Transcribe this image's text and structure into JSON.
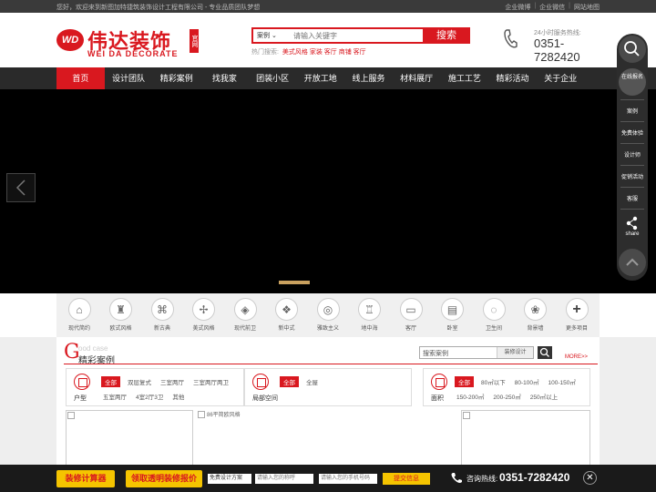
{
  "topbar": {
    "welcome": "您好，欢迎来到新图加特捷筑装饰设计工程有限公司 - 专业品质团队梦想",
    "links": [
      "企业微博",
      "企业微信",
      "网站地图"
    ]
  },
  "logo": {
    "badge": "WD",
    "cn": "伟达装饰",
    "en": "WEI DA DECORATE",
    "official": "官网"
  },
  "search": {
    "category": "案例",
    "placeholder": "请输入关键字",
    "button": "搜索",
    "hot_label": "热门搜索:",
    "hot_keywords": "美式风格 家装 客厅 商铺 客厅"
  },
  "hotline": {
    "label": "24小时服务热线:",
    "number": "0351-7282420"
  },
  "nav": [
    "首页",
    "设计团队",
    "精彩案例",
    "找我家",
    "团装小区",
    "开放工地",
    "线上服务",
    "材料展厅",
    "施工工艺",
    "精彩活动",
    "关于企业"
  ],
  "categories": [
    {
      "label": "现代简约",
      "glyph": "⌂"
    },
    {
      "label": "欧式风格",
      "glyph": "♜"
    },
    {
      "label": "新古典",
      "glyph": "⌘"
    },
    {
      "label": "美式风格",
      "glyph": "✢"
    },
    {
      "label": "现代前卫",
      "glyph": "◈"
    },
    {
      "label": "新中式",
      "glyph": "❖"
    },
    {
      "label": "雅致主义",
      "glyph": "◎"
    },
    {
      "label": "地中海",
      "glyph": "♖"
    },
    {
      "label": "客厅",
      "glyph": "▭"
    },
    {
      "label": "卧室",
      "glyph": "▤"
    },
    {
      "label": "卫生间",
      "glyph": "◌"
    },
    {
      "label": "背景墙",
      "glyph": "❀"
    },
    {
      "label": "更多项目",
      "glyph": "+"
    }
  ],
  "cases": {
    "title_letter": "G",
    "title_en": "ood case",
    "title_cn": "精彩案例",
    "search_placeholder": "搜索案例",
    "search_type": "装修设计",
    "more": "MORE>>",
    "filters": {
      "huxing": {
        "label": "户型",
        "options": [
          "全部",
          "双层复式",
          "三室两厅",
          "三室两厅两卫",
          "五室两厅",
          "4室2厅3卫",
          "其他"
        ]
      },
      "jubu": {
        "label": "局部空间",
        "options": [
          "全部",
          "全屋"
        ]
      },
      "mianji": {
        "label": "面积",
        "options": [
          "全部",
          "80㎡以下",
          "80-100㎡",
          "100-150㎡",
          "150-200㎡",
          "200-250㎡",
          "250㎡以上"
        ]
      }
    },
    "image_alt": "86平简欧风格"
  },
  "sidebar": {
    "online": "在线报名",
    "items": [
      "案例",
      "免费体验",
      "设计师",
      "促销活动",
      "客服"
    ],
    "share": "share"
  },
  "bottombar": {
    "calc": "装修计算器",
    "quote": "领取透明装修报价",
    "select": "免费设计方案",
    "name_placeholder": "请输入您的称呼",
    "phone_placeholder": "请输入您的手机号码",
    "submit": "提交信息",
    "consult_label": "咨询热线:",
    "consult_number": "0351-7282420",
    "close": "✕"
  },
  "colors": {
    "brand_red": "#d9181f",
    "accent_yellow": "#f5c400"
  }
}
